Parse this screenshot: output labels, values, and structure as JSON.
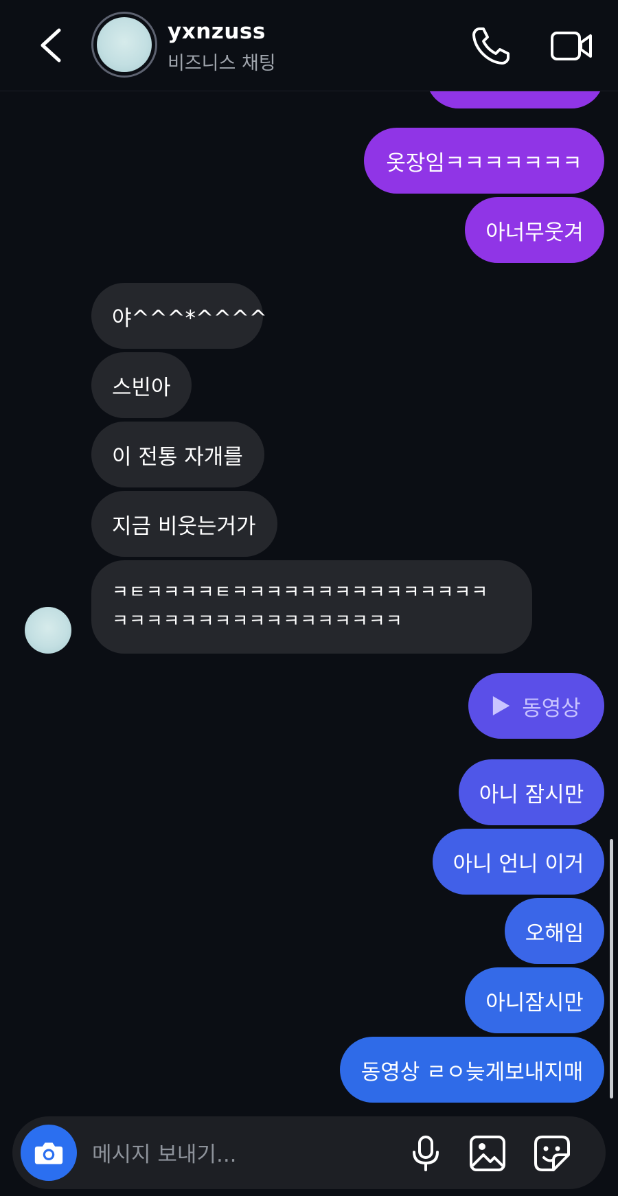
{
  "header": {
    "username": "yxnzuss",
    "subtitle": "비즈니스 채팅",
    "icons": [
      "back-arrow-icon",
      "phone-icon",
      "video-camera-icon"
    ]
  },
  "messages": [
    {
      "from": "me",
      "text": "옷장임ㅋㅋㅋㅋㅋㅋㅋ"
    },
    {
      "from": "me",
      "text": "아너무웃겨"
    },
    {
      "from": "them",
      "text": "야^^^*^^^^"
    },
    {
      "from": "them",
      "text": "스빈아"
    },
    {
      "from": "them",
      "text": "이 전통 자개를"
    },
    {
      "from": "them",
      "text": "지금 비웃는거가"
    },
    {
      "from": "them",
      "lines": [
        "ㅋㅌㅋㅋㅋㅋㅌㅋㅋㅋㅋㅋㅋㅋㅋㅋㅋㅋㅋㅋㅋㅋ",
        "ㅋㅋㅋㅋㅋㅋㅋㅋㅋㅋㅋㅋㅋㅋㅋㅋㅋ"
      ]
    },
    {
      "from": "me",
      "type": "video",
      "text": "동영상"
    },
    {
      "from": "me",
      "text": "아니 잠시만"
    },
    {
      "from": "me",
      "text": "아니 언니 이거"
    },
    {
      "from": "me",
      "text": "오해임"
    },
    {
      "from": "me",
      "text": "아니잠시만"
    },
    {
      "from": "me",
      "text": "동영상 ㄹㅇ늦게보내지매"
    }
  ],
  "composer": {
    "placeholder": "메시지 보내기...",
    "icons": [
      "camera-icon",
      "microphone-icon",
      "gallery-icon",
      "sticker-icon"
    ]
  },
  "colors": {
    "background": "#0b0e14",
    "received_bubble": "#25272c",
    "sent_purple": "#9035e6",
    "sent_violet": "#5b4fe8",
    "sent_blue": "#2f6be8",
    "camera_button": "#2b6ff0"
  }
}
